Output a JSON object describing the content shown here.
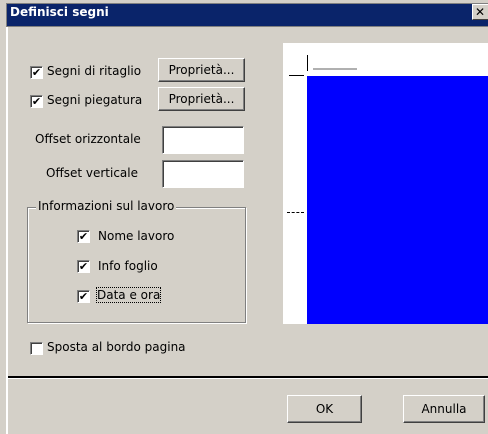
{
  "window": {
    "title": "Definisci segni",
    "close_glyph": "✕"
  },
  "options": {
    "crop_marks": {
      "label": "Segni di ritaglio",
      "checked": true,
      "properties_label": "Proprietà..."
    },
    "fold_marks": {
      "label": "Segni piegatura",
      "checked": true,
      "properties_label": "Proprietà..."
    },
    "horizontal_offset": {
      "label": "Offset orizzontale",
      "value": ""
    },
    "vertical_offset": {
      "label": "Offset verticale",
      "value": ""
    }
  },
  "job_info": {
    "title": "Informazioni sul lavoro",
    "job_name": {
      "label": "Nome lavoro",
      "checked": true
    },
    "sheet_info": {
      "label": "Info foglio",
      "checked": true
    },
    "date_time": {
      "label": "Data e ora",
      "checked": true
    }
  },
  "move_to_edge": {
    "label": "Sposta al bordo pagina",
    "checked": false
  },
  "buttons": {
    "ok": "OK",
    "cancel": "Annulla"
  },
  "check_glyph": "✔",
  "colors": {
    "titlebar": "#0a246a",
    "preview_page": "#0000ff",
    "dialog_bg": "#d4d0c8"
  }
}
